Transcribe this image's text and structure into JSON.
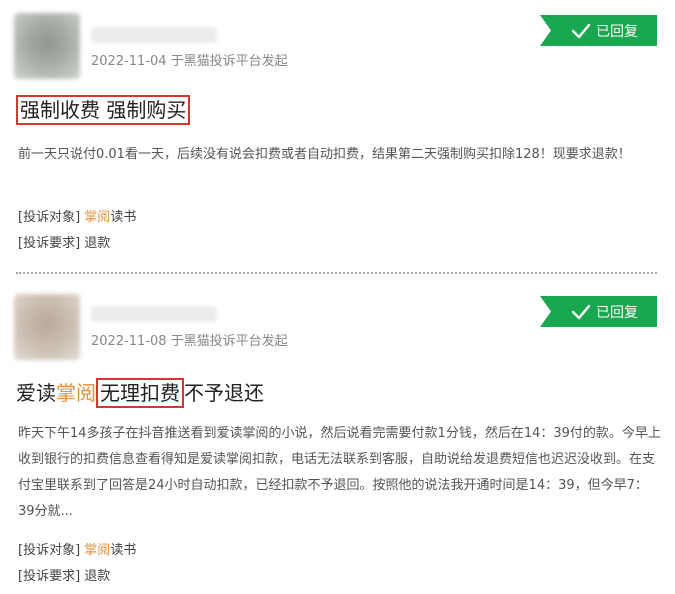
{
  "complaints": [
    {
      "date_line": "2022-11-04 于黑猫投诉平台发起",
      "status_label": "已回复",
      "title": {
        "text": "强制收费 强制购买"
      },
      "description": "前一天只说付0.01看一天，后续没有说会扣费或者自动扣费，结果第二天强制购买扣除128！现要求退款！",
      "target_label": "[投诉对象]",
      "target_app": "掌阅",
      "target_suffix": "读书",
      "request_label": "[投诉要求]",
      "request_value": "退款"
    },
    {
      "date_line": "2022-11-08 于黑猫投诉平台发起",
      "status_label": "已回复",
      "title": {
        "part1": "爱读",
        "part2": "掌阅",
        "part3": "无理扣费",
        "part4": "不予退还"
      },
      "description": "昨天下午14多孩子在抖音推送看到爱读掌阅的小说，然后说看完需要付款1分钱，然后在14：39付的款。今早上收到银行的扣费信息查看得知是爱读掌阅扣款，电话无法联系到客服，自助说给发退费短信也迟迟没收到。在支付宝里联系到了回答是24小时自动扣款，已经扣款不予退回。按照他的说法我开通时间是14：39，但今早7：39分就...",
      "target_label": "[投诉对象]",
      "target_app": "掌阅",
      "target_suffix": "读书",
      "request_label": "[投诉要求]",
      "request_value": "退款"
    }
  ],
  "colors": {
    "badge_green": "#19a74f",
    "highlight_red": "#d0392f",
    "app_orange": "#e7913d"
  },
  "icons": {
    "status": "check-icon"
  }
}
